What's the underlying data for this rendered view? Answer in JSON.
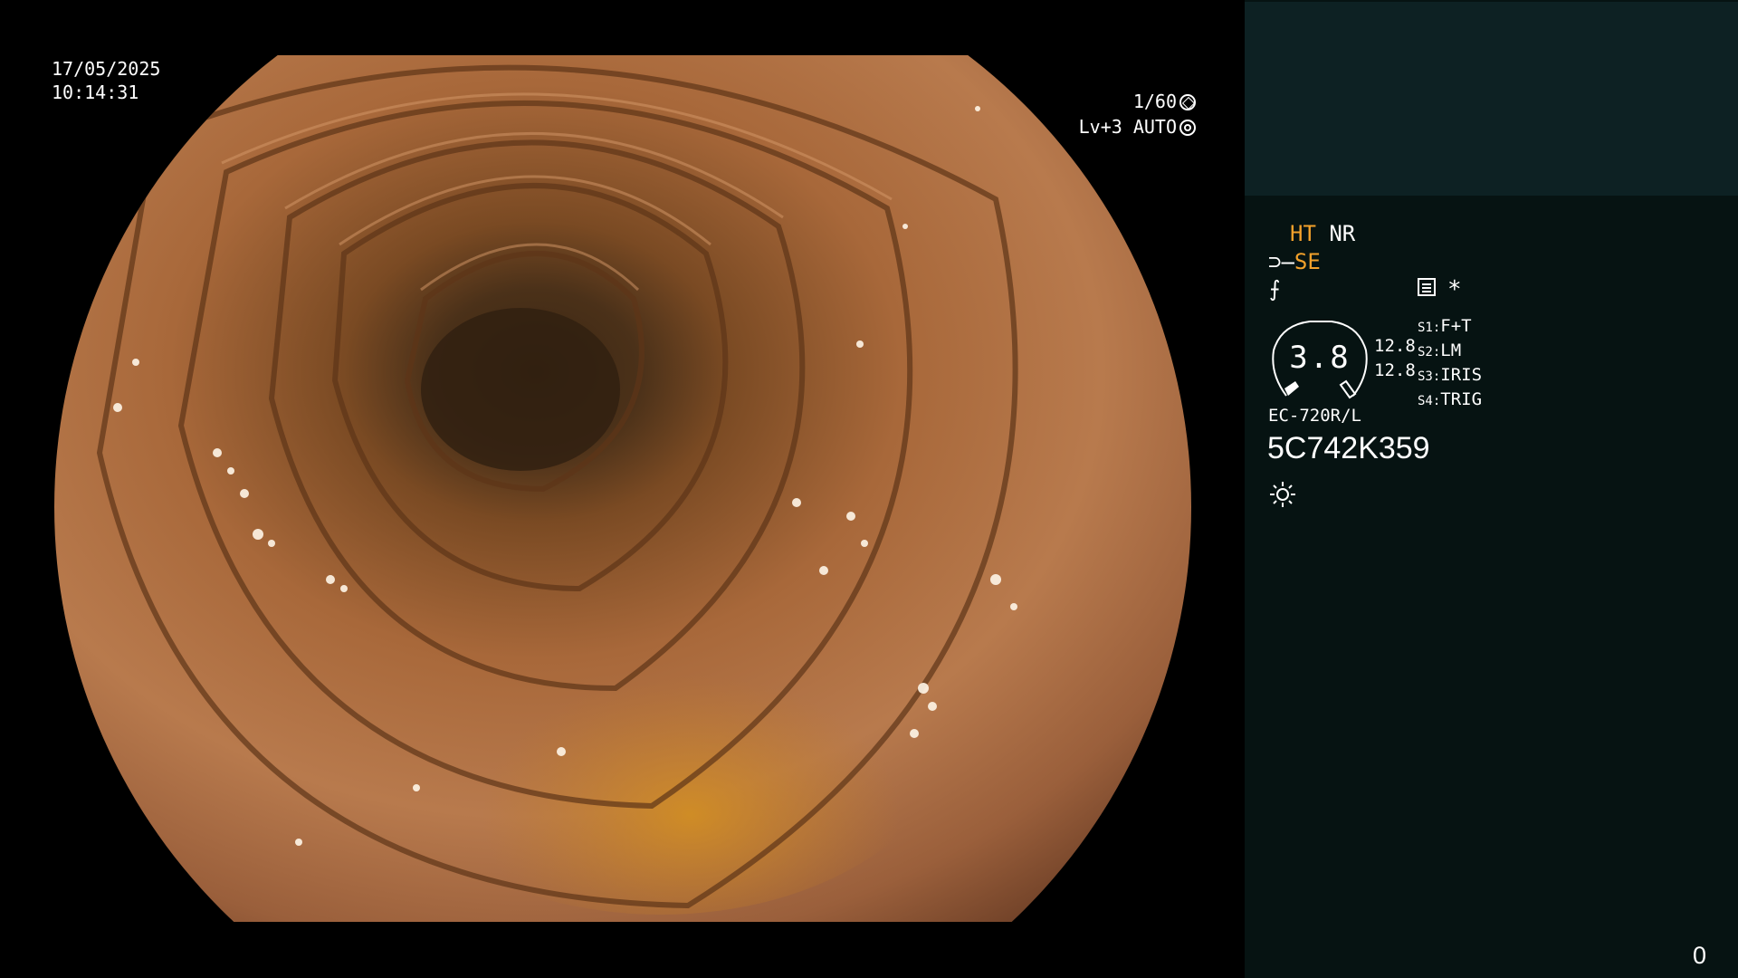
{
  "overlay": {
    "date": "17/05/2025",
    "time": "10:14:31",
    "shutter": "1/60",
    "level_mode": "Lv+3 AUTO"
  },
  "panel": {
    "ht": "HT",
    "nr": "NR",
    "se": "SE",
    "asterisk": "*",
    "gauge_value": "3.8",
    "num_top": "12.8",
    "num_bottom": "12.8",
    "switches": [
      {
        "key": "S1:",
        "value": "F+T"
      },
      {
        "key": "S2:",
        "value": "LM"
      },
      {
        "key": "S3:",
        "value": "IRIS"
      },
      {
        "key": "S4:",
        "value": "TRIG"
      }
    ],
    "model": "EC-720R/L",
    "serial": "5C742K359",
    "corner_number": "0"
  },
  "colors": {
    "accent_orange": "#f3a12b",
    "panel_bg": "#061312",
    "panel_top_bg": "#0d2123"
  },
  "icons": [
    "aperture-icon",
    "iris-icon",
    "scope-curve-icon",
    "document-icon",
    "light-sun-icon"
  ]
}
